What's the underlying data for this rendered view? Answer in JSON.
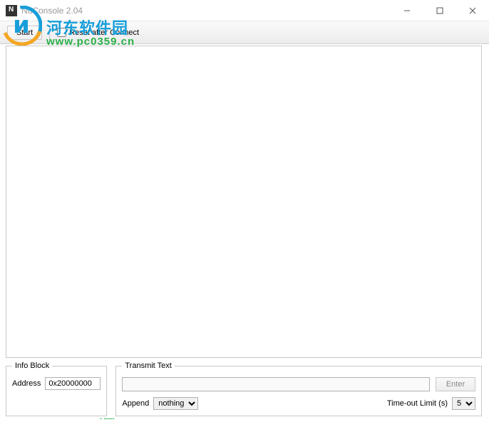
{
  "window": {
    "title": "NuConsole 2.04"
  },
  "toolbar": {
    "start_label": "Start",
    "reset_label": "Reset after Connect"
  },
  "info_block": {
    "legend": "Info Block",
    "address_label": "Address",
    "address_value": "0x20000000"
  },
  "transmit": {
    "legend": "Transmit Text",
    "input_value": "",
    "enter_label": "Enter",
    "append_label": "Append",
    "append_options": [
      "nothing"
    ],
    "append_selected": "nothing",
    "timeout_label": "Time-out Limit (s)",
    "timeout_options": [
      "5"
    ],
    "timeout_selected": "5"
  },
  "watermark": {
    "line1": "河东软件园",
    "line2": "www.pc0359.cn"
  }
}
